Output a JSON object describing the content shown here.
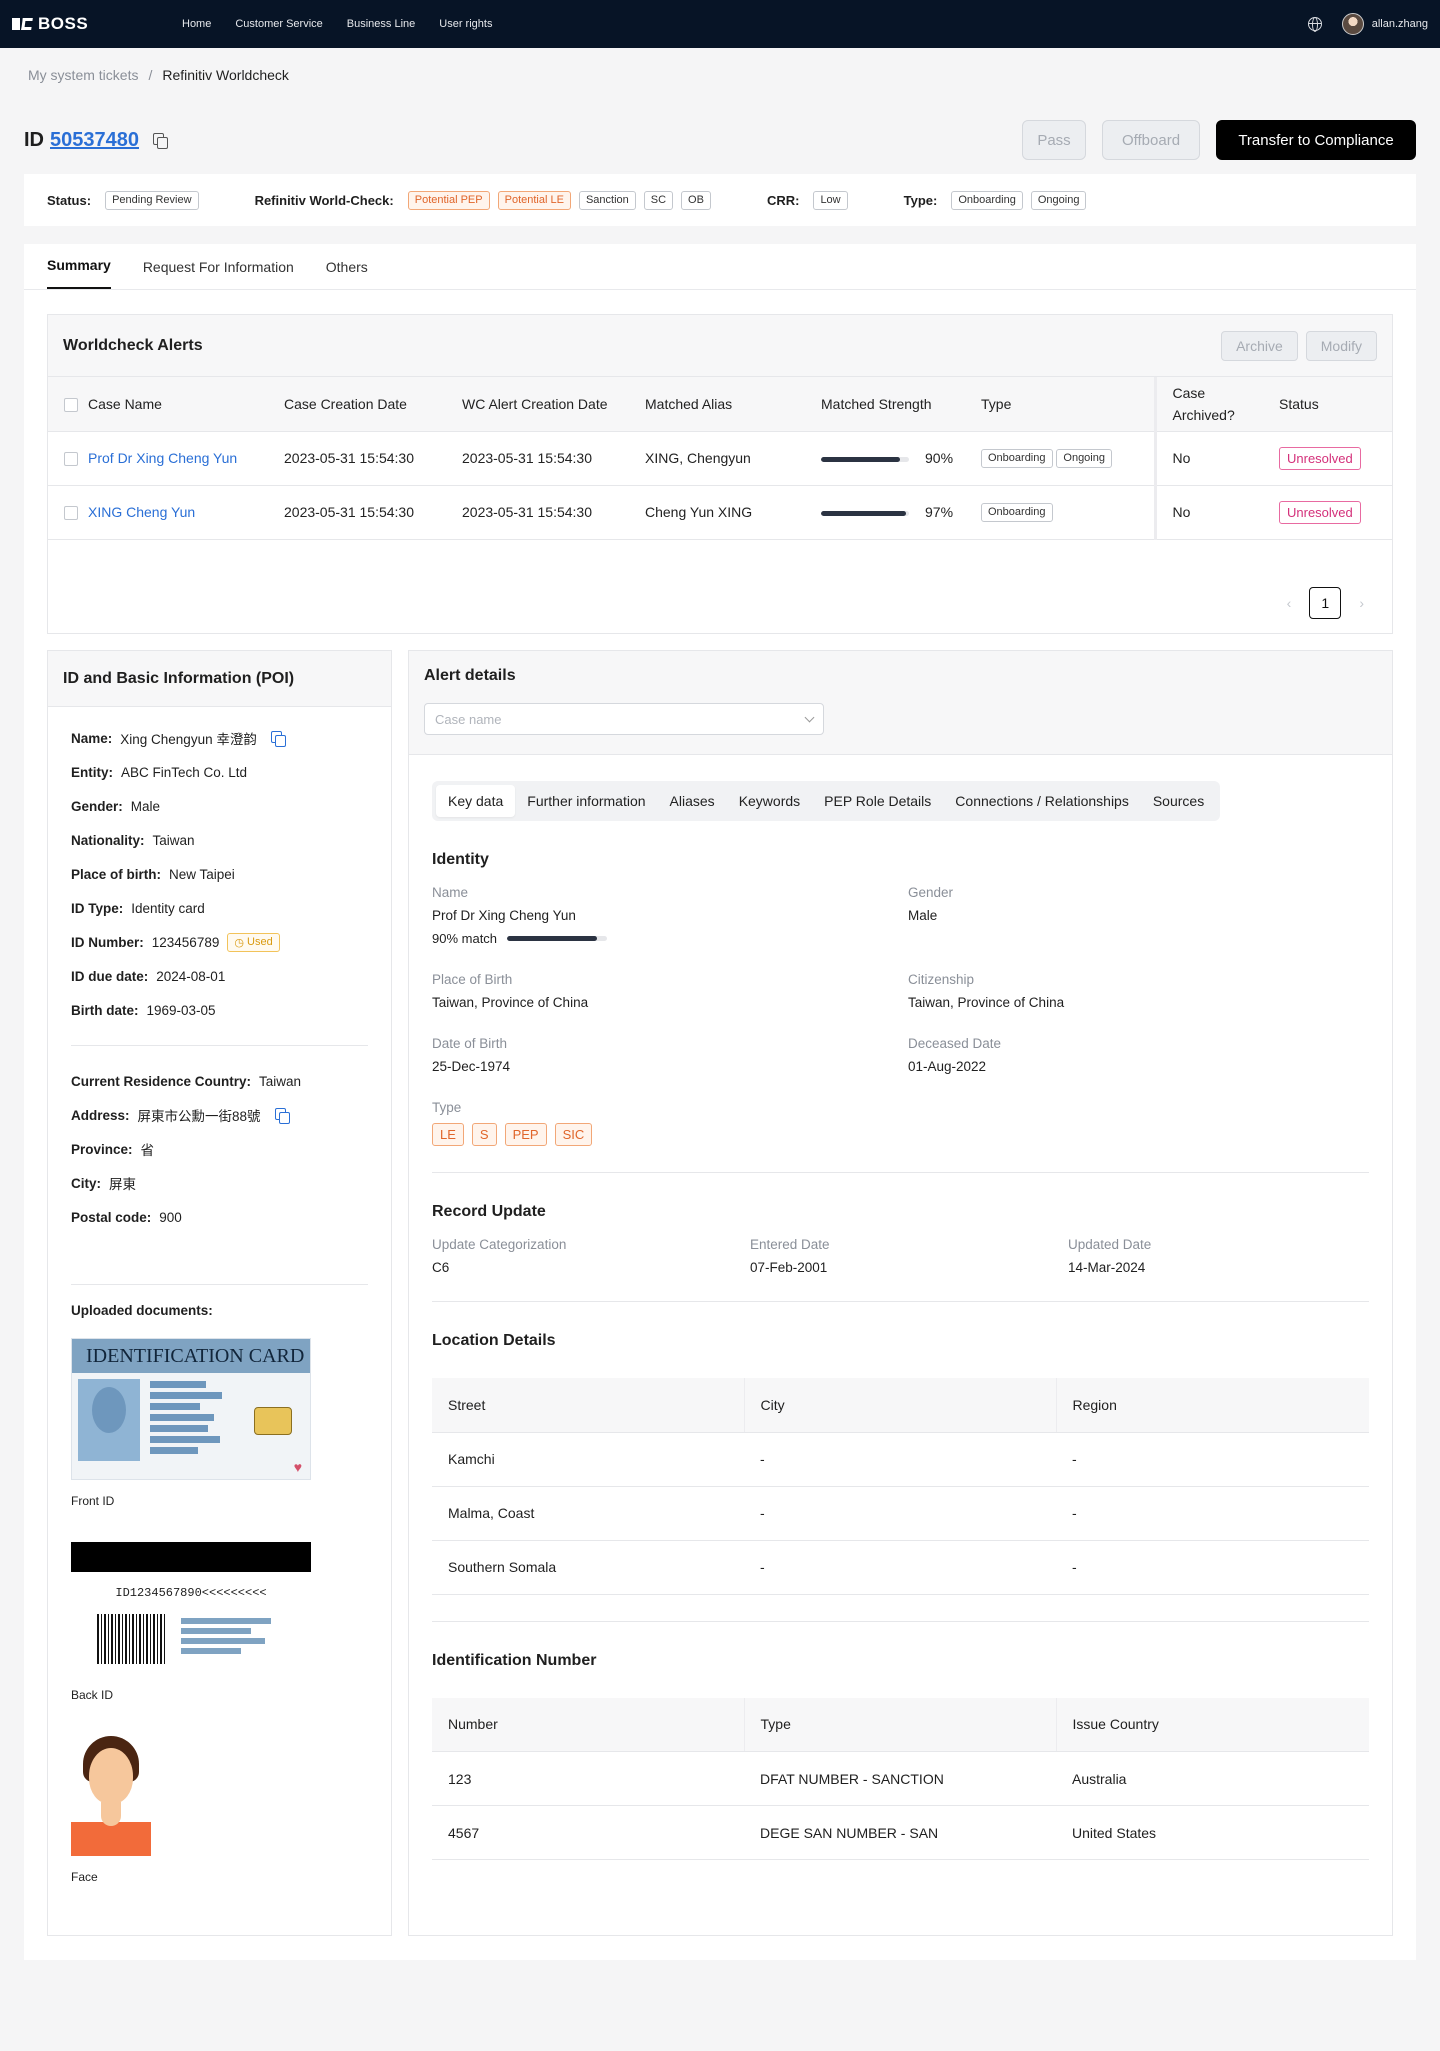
{
  "nav": {
    "brand": "BOSS",
    "items": [
      "Home",
      "Customer Service",
      "Business Line",
      "User rights"
    ],
    "user": "allan.zhang"
  },
  "breadcrumb": [
    "My system tickets",
    "Refinitiv Worldcheck"
  ],
  "ticket": {
    "id_label": "ID",
    "id": "50537480",
    "actions": {
      "pass": "Pass",
      "offboard": "Offboard",
      "transfer": "Transfer to Compliance"
    }
  },
  "status_bar": {
    "status_label": "Status:",
    "status": "Pending Review",
    "wc_label": "Refinitiv World-Check:",
    "wc_tags": [
      "Potential PEP",
      "Potential LE",
      "Sanction",
      "SC",
      "OB"
    ],
    "crr_label": "CRR:",
    "crr": "Low",
    "type_label": "Type:",
    "types": [
      "Onboarding",
      "Ongoing"
    ]
  },
  "tabs": [
    "Summary",
    "Request For Information",
    "Others"
  ],
  "alerts": {
    "title": "Worldcheck Alerts",
    "archive": "Archive",
    "modify": "Modify",
    "columns": [
      "Case Name",
      "Case Creation Date",
      "WC Alert Creation Date",
      "Matched Alias",
      "Matched Strength",
      "Type",
      "Case Archived?",
      "Status"
    ],
    "rows": [
      {
        "name": "Prof Dr Xing Cheng Yun",
        "created": "2023-05-31 15:54:30",
        "wc_created": "2023-05-31 15:54:30",
        "alias": "XING, Chengyun",
        "strength": 90,
        "strength_label": "90%",
        "types": [
          "Onboarding",
          "Ongoing"
        ],
        "archived": "No",
        "status": "Unresolved"
      },
      {
        "name": "XING Cheng Yun",
        "created": "2023-05-31 15:54:30",
        "wc_created": "2023-05-31 15:54:30",
        "alias": "Cheng Yun XING",
        "strength": 97,
        "strength_label": "97%",
        "types": [
          "Onboarding"
        ],
        "archived": "No",
        "status": "Unresolved"
      }
    ],
    "page": "1"
  },
  "poi": {
    "title": "ID and Basic Information (POI)",
    "fields": [
      {
        "label": "Name:",
        "value": "Xing Chengyun 幸澄韵"
      },
      {
        "label": "Entity:",
        "value": "ABC FinTech Co. Ltd"
      },
      {
        "label": "Gender:",
        "value": "Male"
      },
      {
        "label": "Nationality:",
        "value": "Taiwan"
      },
      {
        "label": "Place of birth:",
        "value": "New Taipei"
      },
      {
        "label": "ID Type:",
        "value": "Identity card"
      },
      {
        "label": "ID Number:",
        "value": "123456789"
      },
      {
        "label": "ID due date:",
        "value": "2024-08-01"
      },
      {
        "label": "Birth date:",
        "value": "1969-03-05"
      }
    ],
    "used_tag": "Used",
    "address_fields": [
      {
        "label": "Current Residence Country:",
        "value": "Taiwan"
      },
      {
        "label": "Address:",
        "value": "屏東市公勳一街88號"
      },
      {
        "label": "Province:",
        "value": "省"
      },
      {
        "label": "City:",
        "value": "屏東"
      },
      {
        "label": "Postal code:",
        "value": "900"
      }
    ],
    "docs_label": "Uploaded documents:",
    "front_card_title": "IDENTIFICATION CARD",
    "front_label": "Front ID",
    "back_mrz": "ID1234567890<<<<<<<<<",
    "back_label": "Back ID",
    "face_label": "Face"
  },
  "details": {
    "title": "Alert details",
    "select_placeholder": "Case name",
    "tabs": [
      "Key data",
      "Further information",
      "Aliases",
      "Keywords",
      "PEP Role Details",
      "Connections / Relationships",
      "Sources"
    ],
    "identity": {
      "title": "Identity",
      "name_label": "Name",
      "name": "Prof Dr Xing Cheng Yun",
      "match_label": "90% match",
      "match": 90,
      "gender_label": "Gender",
      "gender": "Male",
      "pob_label": "Place of Birth",
      "pob": "Taiwan, Province of China",
      "citizenship_label": "Citizenship",
      "citizenship": "Taiwan, Province of China",
      "dob_label": "Date of Birth",
      "dob": "25-Dec-1974",
      "deceased_label": "Deceased Date",
      "deceased": "01-Aug-2022",
      "type_label": "Type",
      "types": [
        "LE",
        "S",
        "PEP",
        "SIC"
      ]
    },
    "record": {
      "title": "Record Update",
      "cat_label": "Update Categorization",
      "cat": "C6",
      "entered_label": "Entered Date",
      "entered": "07-Feb-2001",
      "updated_label": "Updated Date",
      "updated": "14-Mar-2024"
    },
    "location": {
      "title": "Location Details",
      "columns": [
        "Street",
        "City",
        "Region"
      ],
      "rows": [
        [
          "Kamchi",
          "-",
          "-"
        ],
        [
          "Malma, Coast",
          "-",
          "-"
        ],
        [
          "Southern Somala",
          "-",
          "-"
        ]
      ]
    },
    "idnum": {
      "title": "Identification Number",
      "columns": [
        "Number",
        "Type",
        "Issue Country"
      ],
      "rows": [
        [
          "123",
          "DFAT NUMBER - SANCTION",
          "Australia"
        ],
        [
          "4567",
          "DEGE SAN NUMBER - SAN",
          "United States"
        ]
      ]
    }
  }
}
